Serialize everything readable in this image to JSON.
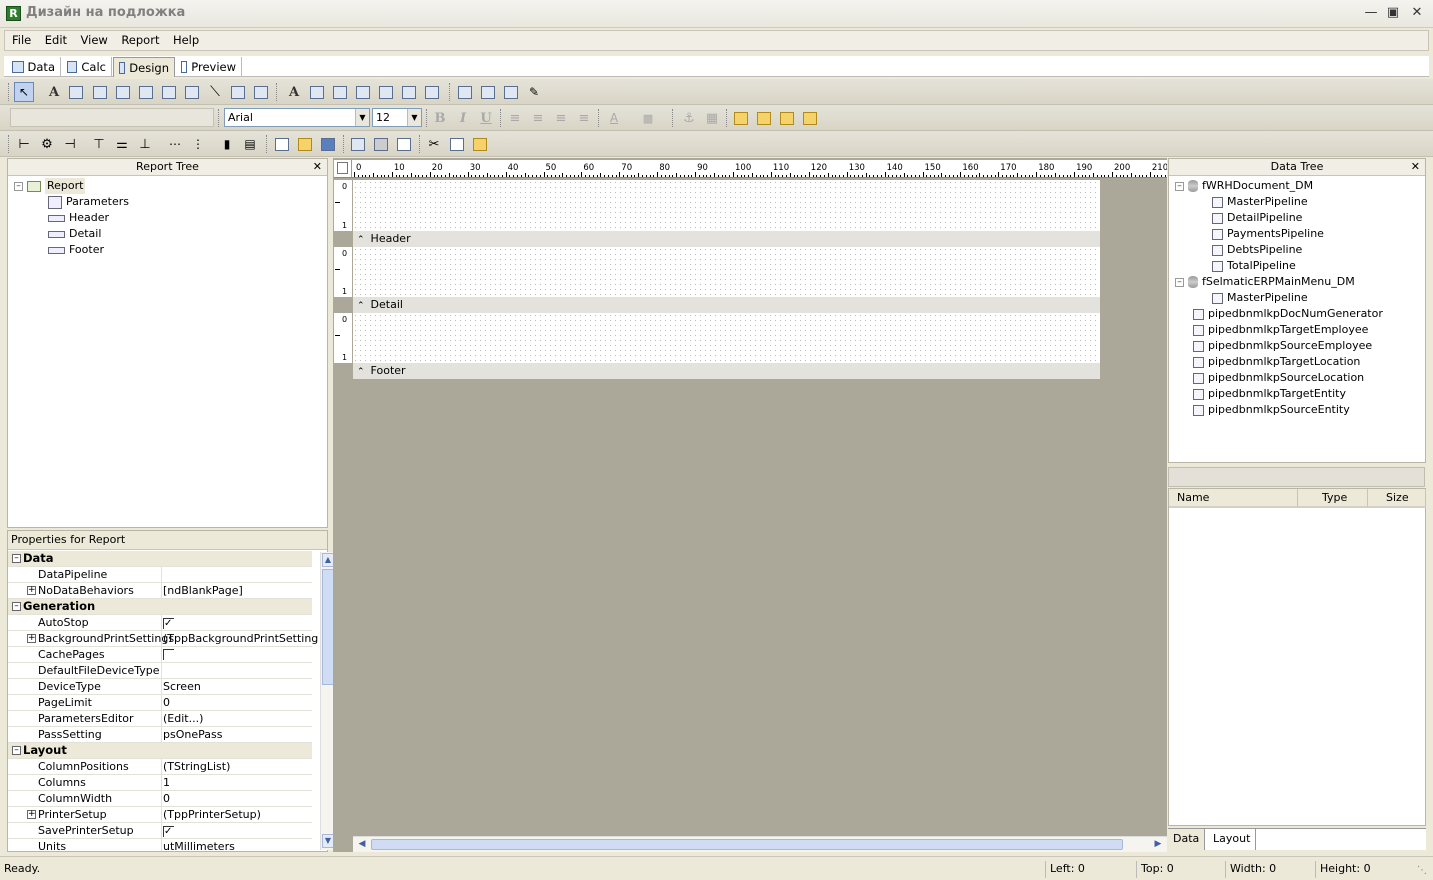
{
  "window": {
    "title": "Дизайн на подложка",
    "app_icon_letter": "R"
  },
  "menu": [
    "File",
    "Edit",
    "View",
    "Report",
    "Help"
  ],
  "page_tabs": [
    "Data",
    "Calc",
    "Design",
    "Preview"
  ],
  "active_tab": "Design",
  "format_toolbar": {
    "font_name": "Arial",
    "font_size": "12"
  },
  "report_tree": {
    "title": "Report Tree",
    "root": "Report",
    "children": [
      "Parameters",
      "Header",
      "Detail",
      "Footer"
    ]
  },
  "properties": {
    "title": "Properties for Report",
    "rows": [
      {
        "kind": "cat",
        "name": "Data"
      },
      {
        "name": "DataPipeline",
        "value": ""
      },
      {
        "name": "NoDataBehaviors",
        "value": "[ndBlankPage]",
        "expand": true
      },
      {
        "kind": "cat",
        "name": "Generation"
      },
      {
        "name": "AutoStop",
        "value": "",
        "check": true
      },
      {
        "name": "BackgroundPrintSettings",
        "value": "(TppBackgroundPrintSettings)",
        "expand": true
      },
      {
        "name": "CachePages",
        "value": "",
        "check": false
      },
      {
        "name": "DefaultFileDeviceType",
        "value": ""
      },
      {
        "name": "DeviceType",
        "value": "Screen"
      },
      {
        "name": "PageLimit",
        "value": "0"
      },
      {
        "name": "ParametersEditor",
        "value": "(Edit...)"
      },
      {
        "name": "PassSetting",
        "value": "psOnePass"
      },
      {
        "kind": "cat",
        "name": "Layout"
      },
      {
        "name": "ColumnPositions",
        "value": "(TStringList)"
      },
      {
        "name": "Columns",
        "value": "1"
      },
      {
        "name": "ColumnWidth",
        "value": "0"
      },
      {
        "name": "PrinterSetup",
        "value": "(TppPrinterSetup)",
        "expand": true
      },
      {
        "name": "SavePrinterSetup",
        "value": "",
        "check": true
      },
      {
        "name": "Units",
        "value": "utMillimeters"
      }
    ]
  },
  "ruler_labels": [
    "0",
    "10",
    "20",
    "30",
    "40",
    "50",
    "60",
    "70",
    "80",
    "90",
    "100",
    "110",
    "120",
    "130",
    "140",
    "150",
    "160",
    "170",
    "180",
    "190",
    "200",
    "210"
  ],
  "bands": [
    {
      "label": "Header",
      "ruler_top": "0",
      "ruler_bottom": "1"
    },
    {
      "label": "Detail",
      "ruler_top": "0",
      "ruler_bottom": "1"
    },
    {
      "label": "Footer",
      "ruler_top": "0",
      "ruler_bottom": "1"
    }
  ],
  "data_tree": {
    "title": "Data Tree",
    "groups": [
      {
        "name": "fWRHDocument_DM",
        "items": [
          "MasterPipeline",
          "DetailPipeline",
          "PaymentsPipeline",
          "DebtsPipeline",
          "TotalPipeline"
        ]
      },
      {
        "name": "fSelmaticERPMainMenu_DM",
        "items": [
          "MasterPipeline"
        ]
      }
    ],
    "loose_items": [
      "pipedbnmlkpDocNumGenerator",
      "pipedbnmlkpTargetEmployee",
      "pipedbnmlkpSourceEmployee",
      "pipedbnmlkpTargetLocation",
      "pipedbnmlkpSourceLocation",
      "pipedbnmlkpTargetEntity",
      "pipedbnmlkpSourceEntity"
    ]
  },
  "field_list": {
    "columns": [
      "Name",
      "Type",
      "Size"
    ]
  },
  "bottom_tabs": [
    "Data",
    "Layout"
  ],
  "status": {
    "text": "Ready.",
    "left": "Left: 0",
    "top": "Top: 0",
    "width": "Width: 0",
    "height": "Height: 0"
  }
}
